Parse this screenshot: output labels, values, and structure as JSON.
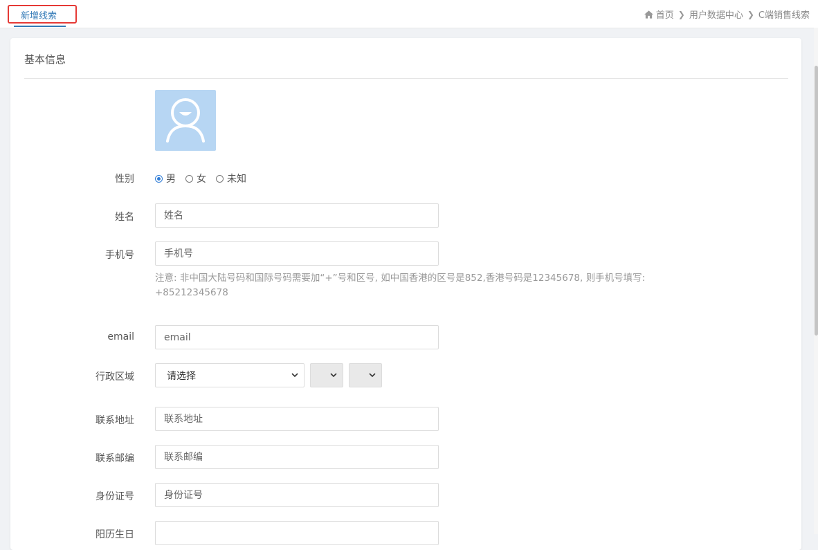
{
  "tab": {
    "label": "新增线索"
  },
  "breadcrumb": {
    "items": [
      "首页",
      "用户数据中心",
      "C端销售线索"
    ]
  },
  "card": {
    "title": "基本信息"
  },
  "avatar": {
    "icon": "user-avatar-icon"
  },
  "gender": {
    "label": "性别",
    "options": [
      "男",
      "女",
      "未知"
    ],
    "selected": "男"
  },
  "name": {
    "label": "姓名",
    "placeholder": "姓名"
  },
  "phone": {
    "label": "手机号",
    "placeholder": "手机号",
    "hint": "注意: 非中国大陆号码和国际号码需要加“+”号和区号, 如中国香港的区号是852,香港号码是12345678, 则手机号填写: +85212345678"
  },
  "email": {
    "label": "email",
    "placeholder": "email"
  },
  "region": {
    "label": "行政区域",
    "selected": "请选择"
  },
  "address": {
    "label": "联系地址",
    "placeholder": "联系地址"
  },
  "postcode": {
    "label": "联系邮编",
    "placeholder": "联系邮编"
  },
  "idcard": {
    "label": "身份证号",
    "placeholder": "身份证号"
  },
  "birthday": {
    "label": "阳历生日"
  },
  "colors": {
    "accent": "#337ab7",
    "highlight": "#e53935",
    "avatar_bg": "#b7d6f3"
  }
}
